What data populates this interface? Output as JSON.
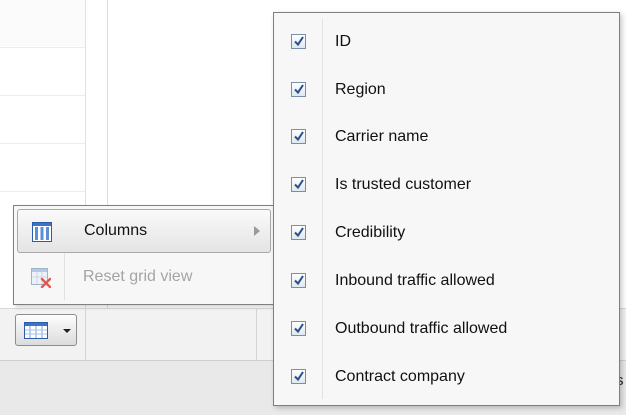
{
  "main_menu": {
    "items": [
      {
        "label": "Columns",
        "icon": "columns-icon",
        "disabled": false,
        "has_submenu": true
      },
      {
        "label": "Reset grid view",
        "icon": "reset-grid-icon",
        "disabled": true,
        "has_submenu": false
      }
    ]
  },
  "columns_menu": {
    "items": [
      {
        "label": "ID",
        "checked": true
      },
      {
        "label": "Region",
        "checked": true
      },
      {
        "label": "Carrier name",
        "checked": true
      },
      {
        "label": "Is trusted customer",
        "checked": true
      },
      {
        "label": "Credibility",
        "checked": true
      },
      {
        "label": "Inbound traffic allowed",
        "checked": true
      },
      {
        "label": "Outbound traffic allowed",
        "checked": true
      },
      {
        "label": "Contract company",
        "checked": true
      }
    ]
  },
  "grid_menu_button": {
    "icon": "grid-menu-icon"
  },
  "status": {
    "partial_text": "s"
  },
  "colors": {
    "check_blue": "#2a4e8a",
    "menu_bg": "#f7f7f7",
    "menu_border": "#7f7f7f",
    "disabled_text": "#a4a4a4"
  }
}
